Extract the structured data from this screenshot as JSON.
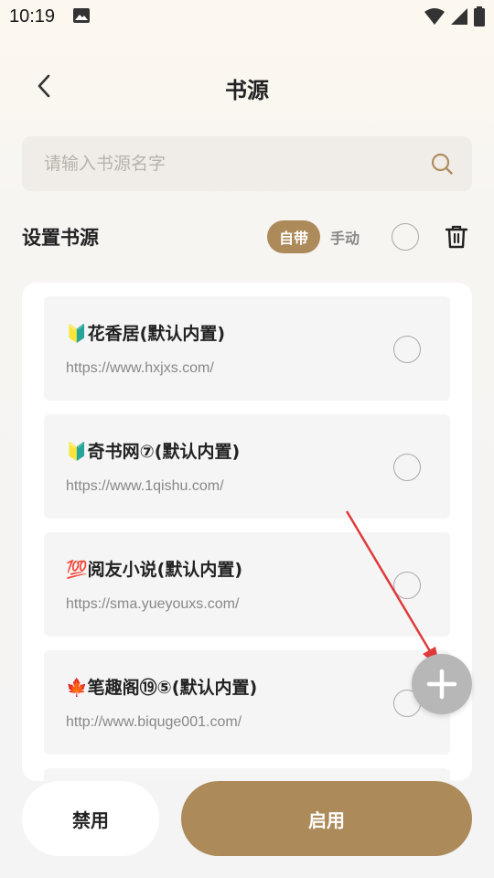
{
  "status_bar": {
    "time": "10:19"
  },
  "header": {
    "title": "书源"
  },
  "search": {
    "placeholder": "请输入书源名字",
    "value": ""
  },
  "section": {
    "title": "设置书源",
    "builtin_label": "自带",
    "manual_label": "手动"
  },
  "sources": [
    {
      "icon": "🔰",
      "name": "花香居(默认内置)",
      "url": "https://www.hxjxs.com/",
      "selected": false
    },
    {
      "icon": "🔰",
      "name": "奇书网⑦(默认内置)",
      "url": "https://www.1qishu.com/",
      "selected": false
    },
    {
      "icon": "💯",
      "name": "阅友小说(默认内置)",
      "url": "https://sma.yueyouxs.com/",
      "selected": false
    },
    {
      "icon": "🍁",
      "name": "笔趣阁⑲⑤(默认内置)",
      "url": "http://www.biquge001.com/",
      "selected": false
    }
  ],
  "actions": {
    "disable_label": "禁用",
    "enable_label": "启用"
  },
  "colors": {
    "accent": "#ad8a5a",
    "annotation_arrow": "#e03a3a",
    "fab": "#b7b7b7"
  },
  "icons": [
    "back-arrow-icon",
    "search-icon",
    "trash-icon",
    "plus-icon",
    "image-icon",
    "wifi-icon",
    "signal-icon",
    "battery-icon"
  ]
}
